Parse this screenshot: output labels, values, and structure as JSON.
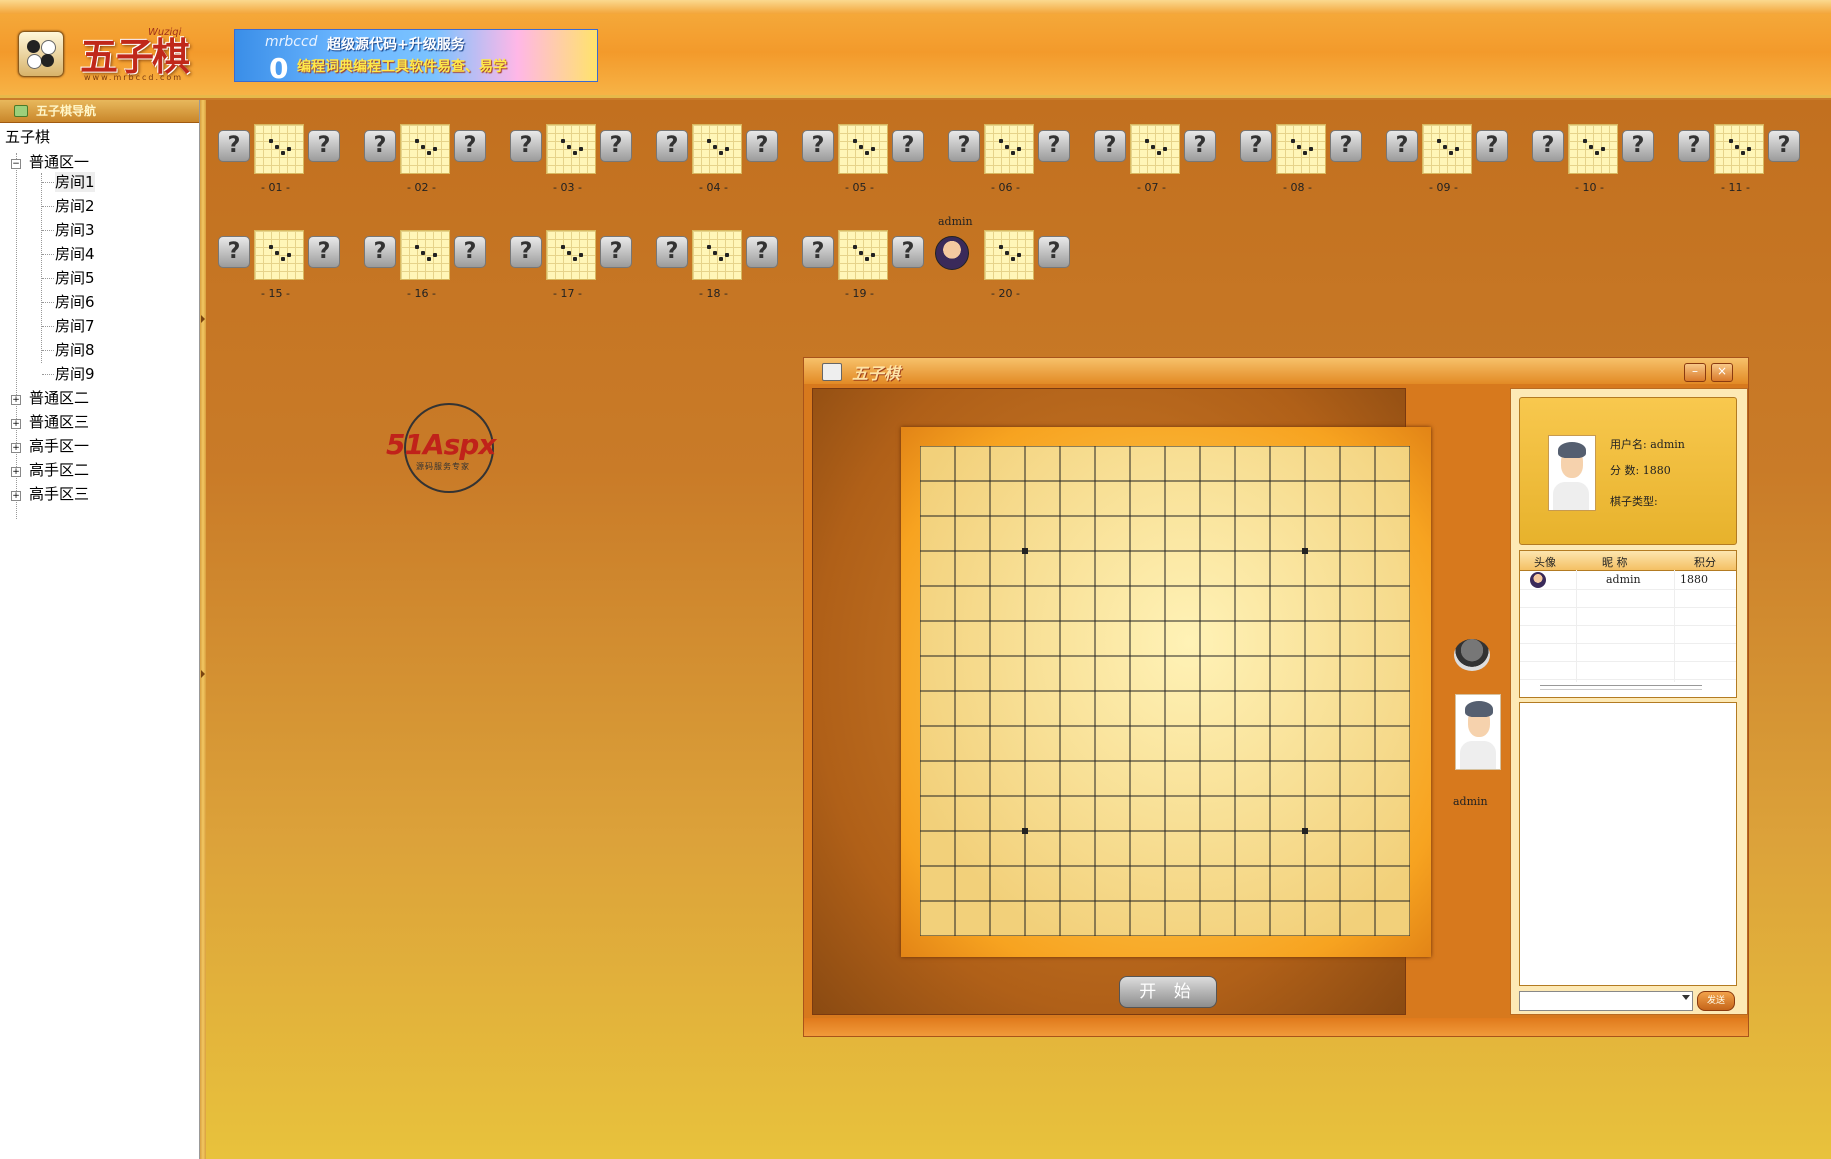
{
  "header": {
    "logo_text": "五子棋",
    "logo_pinyin": "Wuziqi",
    "logo_sub": "www.mrbccd.com",
    "banner_brand": "mrbccd",
    "banner_line1": "超级源代码+升级服务",
    "banner_line2": "编程词典编程工具软件易查、易学",
    "banner_big": "0"
  },
  "nav": {
    "title": "五子棋导航",
    "root": "五子棋",
    "zones": [
      {
        "label": "普通区一",
        "expanded": true,
        "rooms": [
          "房间1",
          "房间2",
          "房间3",
          "房间4",
          "房间5",
          "房间6",
          "房间7",
          "房间8",
          "房间9"
        ]
      },
      {
        "label": "普通区二",
        "expanded": false
      },
      {
        "label": "普通区三",
        "expanded": false
      },
      {
        "label": "高手区一",
        "expanded": false
      },
      {
        "label": "高手区二",
        "expanded": false
      },
      {
        "label": "高手区三",
        "expanded": false
      }
    ]
  },
  "tables": {
    "row1": [
      "- 01 -",
      "- 02 -",
      "- 03 -",
      "- 04 -",
      "- 05 -",
      "- 06 -",
      "- 07 -",
      "- 08 -",
      "- 09 -",
      "- 10 -",
      "- 11 -"
    ],
    "row2": [
      "- 15 -",
      "- 16 -",
      "- 17 -",
      "- 18 -",
      "- 19 -",
      "- 20 -"
    ],
    "seated_player": "admin",
    "seated_table": "- 20 -",
    "empty_seat_glyph": "?"
  },
  "watermark": {
    "main": "51Aspx",
    "sub": "源码服务专家"
  },
  "game_window": {
    "title": "五子棋",
    "minimize": "–",
    "close": "×",
    "start_button": "开 始",
    "opponent_name": "admin",
    "info": {
      "username_label": "用户名:",
      "username": "admin",
      "score_label": "分  数:",
      "score": "1880",
      "piece_label": "棋子类型:",
      "piece": ""
    },
    "user_list": {
      "headers": [
        "头像",
        "昵 称",
        "积分"
      ],
      "rows": [
        {
          "nickname": "admin",
          "score": "1880"
        }
      ]
    },
    "send_button": "发送"
  }
}
